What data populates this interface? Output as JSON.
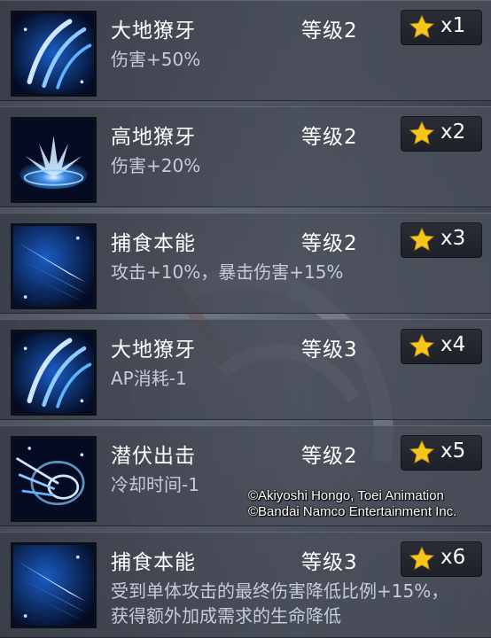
{
  "skills": [
    {
      "name": "大地獠牙",
      "level": "等级2",
      "count": "x1",
      "effect": "伤害+50%",
      "icon": "claw-slash-icon"
    },
    {
      "name": "高地獠牙",
      "level": "等级2",
      "count": "x2",
      "effect": "伤害+20%",
      "icon": "ground-burst-icon"
    },
    {
      "name": "捕食本能",
      "level": "等级2",
      "count": "x3",
      "effect": "攻击+10%，暴击伤害+15%",
      "icon": "triple-slash-icon"
    },
    {
      "name": "大地獠牙",
      "level": "等级3",
      "count": "x4",
      "effect": "AP消耗-1",
      "icon": "claw-slash-icon"
    },
    {
      "name": "潜伏出击",
      "level": "等级2",
      "count": "x5",
      "effect": "冷却时间-1",
      "icon": "dash-ring-icon"
    },
    {
      "name": "捕食本能",
      "level": "等级3",
      "count": "x6",
      "effect": "受到单体攻击的最终伤害降低比例+15%，获得额外加成需求的生命降低",
      "icon": "triple-slash-icon"
    }
  ],
  "copyright": {
    "line1": "©Akiyoshi Hongo, Toei Animation",
    "line2": "©Bandai Namco Entertainment Inc."
  },
  "colors": {
    "star": "#f5c51c",
    "icon_glow": "#5fb4ff"
  }
}
